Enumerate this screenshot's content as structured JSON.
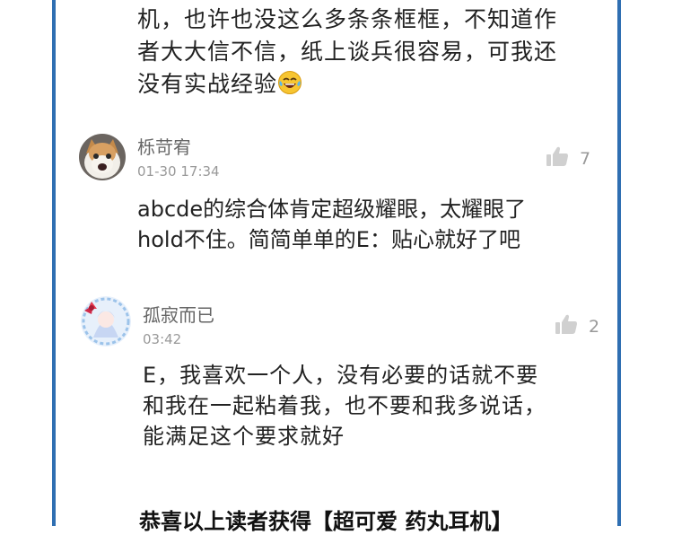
{
  "continued_comment": {
    "line1": "机，也许也没这么多条条框框，不知道作",
    "line2": "者大大信不信，纸上谈兵很容易，可我还",
    "line3": "没有实战经验",
    "emoji": "laughing-tears-emoji"
  },
  "comments": [
    {
      "username": "栎苛宥",
      "time": "01-30 17:34",
      "likes": "7",
      "avatar": "cat-avatar",
      "lines": [
        "abcde的综合体肯定超级耀眼，太耀眼了",
        "hold不住。简简单单的E：贴心就好了吧"
      ]
    },
    {
      "username": "孤寂而已",
      "time": "03:42",
      "likes": "2",
      "avatar": "anime-girl-avatar",
      "lines": [
        "E，我喜欢一个人，没有必要的话就不要",
        "和我在一起粘着我，也不要和我多说话，",
        "能满足这个要求就好"
      ]
    }
  ],
  "footer": {
    "text": "恭喜以上读者获得【超可爱 药丸耳机】"
  },
  "colors": {
    "frame": "#2f6fb2",
    "text": "#222222",
    "meta": "#999999"
  }
}
